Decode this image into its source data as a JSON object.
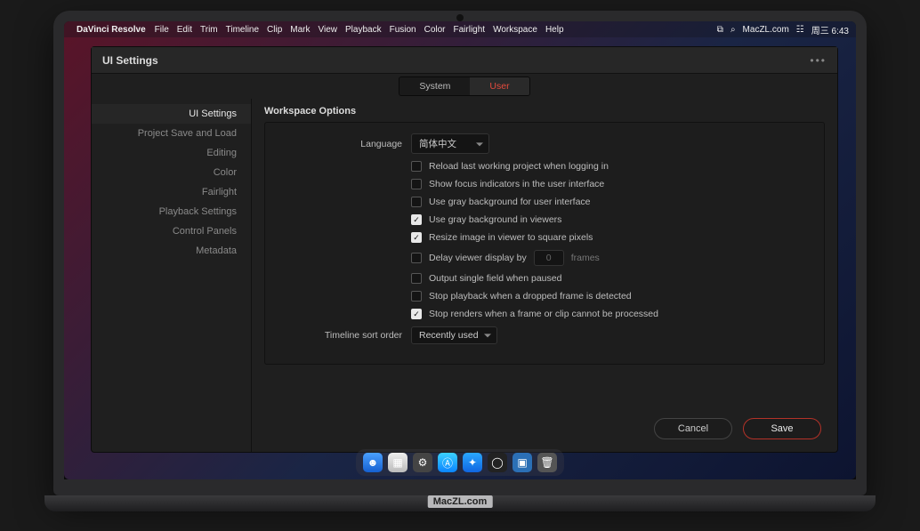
{
  "menubar": {
    "app": "DaVinci Resolve",
    "items": [
      "File",
      "Edit",
      "Trim",
      "Timeline",
      "Clip",
      "Mark",
      "View",
      "Playback",
      "Fusion",
      "Color",
      "Fairlight",
      "Workspace",
      "Help"
    ],
    "site": "MacZL.com",
    "clock": "周三 6:43"
  },
  "window": {
    "title": "UI Settings",
    "tabs": {
      "system": "System",
      "user": "User",
      "active": "user"
    },
    "sidebar": {
      "items": [
        "UI Settings",
        "Project Save and Load",
        "Editing",
        "Color",
        "Fairlight",
        "Playback Settings",
        "Control Panels",
        "Metadata"
      ],
      "active": 0
    },
    "section_title": "Workspace Options",
    "language": {
      "label": "Language",
      "value": "简体中文"
    },
    "options": [
      {
        "checked": false,
        "label": "Reload last working project when logging in"
      },
      {
        "checked": false,
        "label": "Show focus indicators in the user interface"
      },
      {
        "checked": false,
        "label": "Use gray background for user interface"
      },
      {
        "checked": true,
        "label": "Use gray background in viewers"
      },
      {
        "checked": true,
        "label": "Resize image in viewer to square pixels"
      }
    ],
    "delay": {
      "checked": false,
      "label": "Delay viewer display by",
      "value": "0",
      "unit": "frames"
    },
    "options_after": [
      {
        "checked": false,
        "label": "Output single field when paused"
      },
      {
        "checked": false,
        "label": "Stop playback when a dropped frame is detected"
      },
      {
        "checked": true,
        "label": "Stop renders when a frame or clip cannot be processed"
      }
    ],
    "sort": {
      "label": "Timeline sort order",
      "value": "Recently used"
    },
    "buttons": {
      "cancel": "Cancel",
      "save": "Save"
    }
  },
  "watermark": "MacZL.com"
}
